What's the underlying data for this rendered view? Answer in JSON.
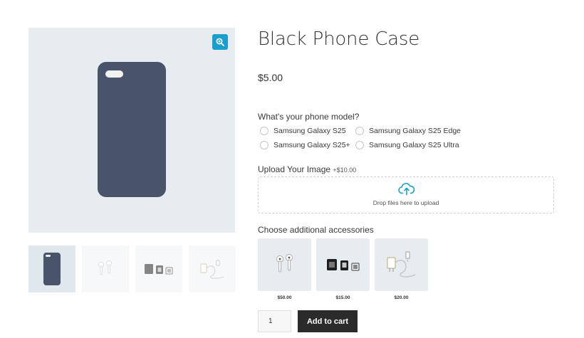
{
  "product": {
    "title": "Black Phone Case",
    "price": "$5.00"
  },
  "gallery": {
    "zoom_icon": "magnifier-zoom-icon",
    "thumbnails": [
      {
        "name": "phone-case",
        "active": true
      },
      {
        "name": "earbuds",
        "active": false
      },
      {
        "name": "sim-cards",
        "active": false
      },
      {
        "name": "charger-cable",
        "active": false
      }
    ]
  },
  "phone_model": {
    "label": "What's your phone model?",
    "options": [
      "Samsung Galaxy S25",
      "Samsung Galaxy S25 Edge",
      "Samsung Galaxy S25+",
      "Samsung Galaxy S25 Ultra"
    ]
  },
  "upload": {
    "label": "Upload Your Image",
    "addon_price": "+$10.00",
    "drop_text": "Drop files here to upload",
    "icon": "cloud-upload-icon"
  },
  "accessories": {
    "label": "Choose additional accessories",
    "items": [
      {
        "name": "earbuds",
        "price": "$50.00"
      },
      {
        "name": "sim-cards",
        "price": "$15.00"
      },
      {
        "name": "charger-cable",
        "price": "$20.00"
      }
    ]
  },
  "cart": {
    "quantity": "1",
    "add_label": "Add to cart"
  },
  "colors": {
    "accent": "#1a9fcc",
    "phone_case": "#49536a",
    "button_dark": "#2b2b2b",
    "image_bg": "#e6ecf0"
  }
}
